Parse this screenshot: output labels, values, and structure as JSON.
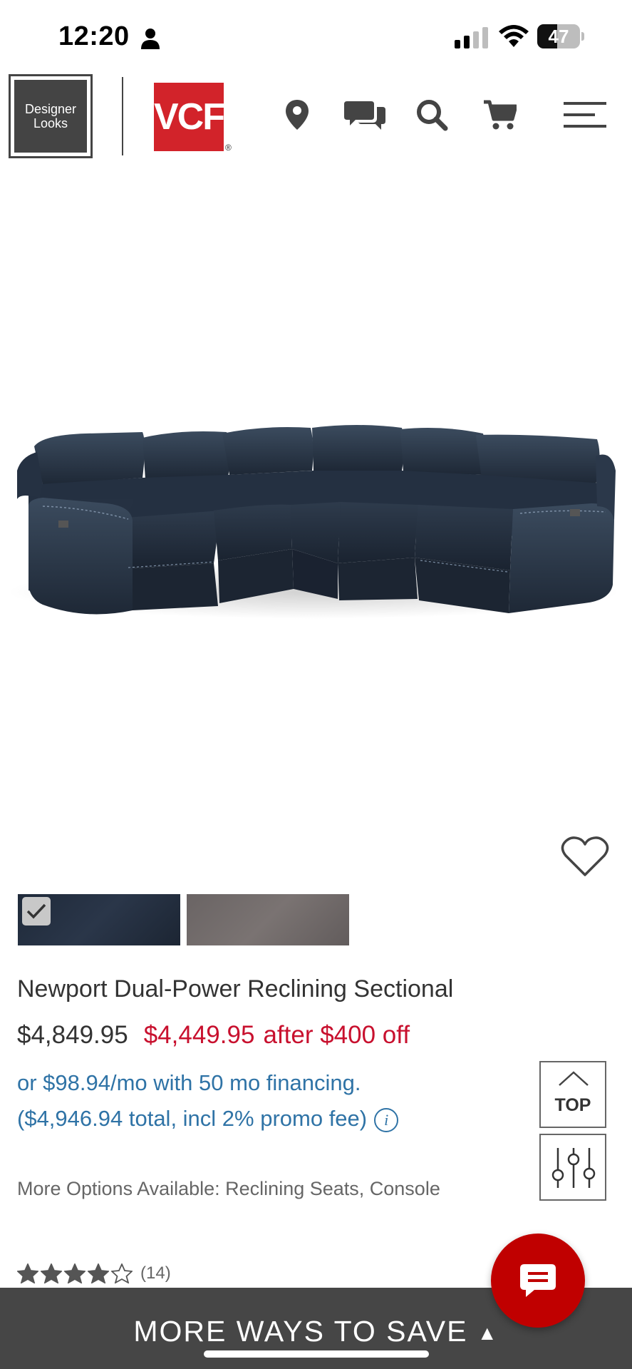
{
  "status_bar": {
    "time": "12:20",
    "battery": "47",
    "battery_level": 0.47
  },
  "header": {
    "designer_logo_line1": "Designer",
    "designer_logo_line2": "Looks",
    "vcf_logo": "VCF",
    "vcf_reg": "®",
    "icons": [
      "location-icon",
      "chat-icon",
      "search-icon",
      "cart-icon",
      "menu-icon"
    ]
  },
  "product": {
    "title": "Newport Dual-Power Reclining Sectional",
    "price_original": "$4,849.95",
    "price_sale": "$4,449.95",
    "price_note": "after $400 off",
    "financing_line1": "or $98.94/mo with 50 mo financing.",
    "financing_line2": "($4,946.94 total, incl 2% promo fee)",
    "info_icon_glyph": "i",
    "more_options": "More Options Available: Reclining Seats, Console",
    "rating_count": "(14)",
    "rating_stars": 4,
    "rating_max": 5,
    "swatch_colors": [
      "#1f2a3a",
      "#6a6464"
    ]
  },
  "side_buttons": {
    "top_label": "TOP"
  },
  "bottom_bar": {
    "label": "MORE WAYS TO SAVE"
  },
  "colors": {
    "brand_red": "#d2232a",
    "sale_red": "#c8102e",
    "link_blue": "#2f73a6",
    "bar_gray": "#464646",
    "chat_red": "#c00000"
  }
}
